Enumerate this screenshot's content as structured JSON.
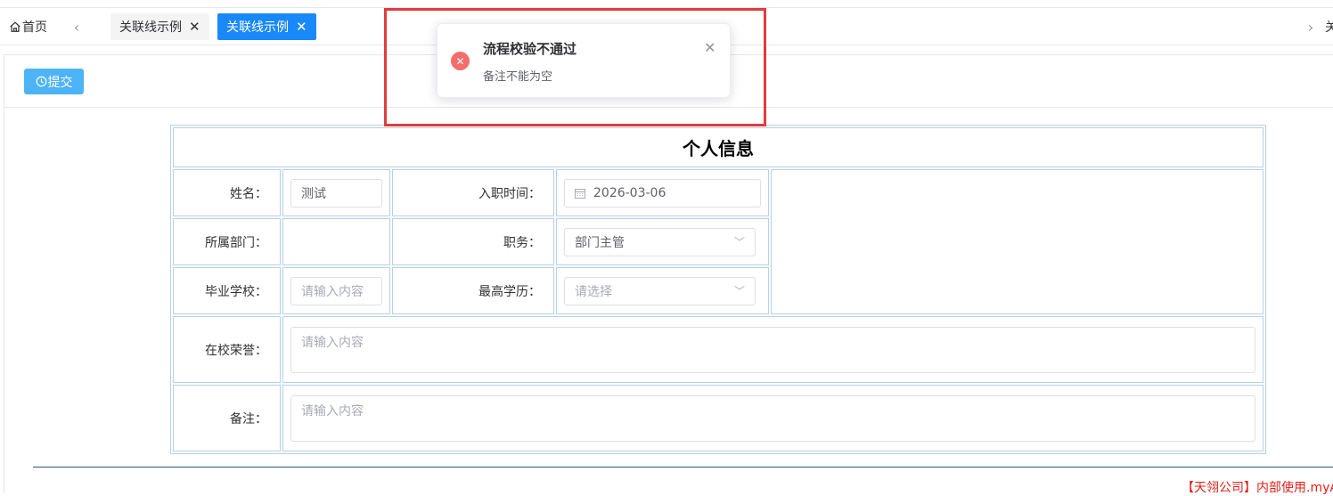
{
  "tabs": {
    "home_label": "首页",
    "items": [
      {
        "label": "关联线示例",
        "active": false
      },
      {
        "label": "关联线示例",
        "active": true
      }
    ],
    "right_overflow_text": "关"
  },
  "toolbar": {
    "submit_label": "提交"
  },
  "form": {
    "title": "个人信息",
    "name_label": "姓名：",
    "name_value": "测试",
    "entry_date_label": "入职时间：",
    "entry_date_value": "2026-03-06",
    "department_label": "所属部门：",
    "department_value": "",
    "position_label": "职务：",
    "position_value": "部门主管",
    "school_label": "毕业学校：",
    "school_placeholder": "请输入内容",
    "education_label": "最高学历：",
    "education_placeholder": "请选择",
    "honors_label": "在校荣誉：",
    "honors_placeholder": "请输入内容",
    "remarks_label": "备注：",
    "remarks_placeholder": "请输入内容"
  },
  "notification": {
    "title": "流程校验不通过",
    "message": "备注不能为空",
    "type_color": "#f56c6c"
  },
  "footer": {
    "note": "【天翎公司】内部使用.myA"
  }
}
